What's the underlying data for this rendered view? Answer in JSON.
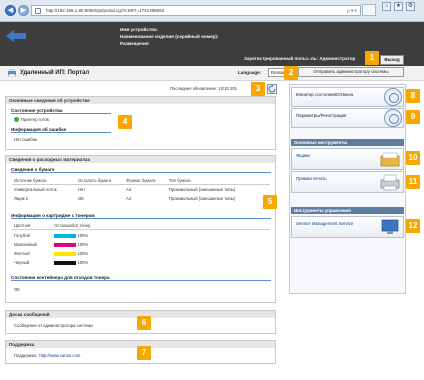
{
  "browser": {
    "address": "http://192.168.1.80:8000/rps/portal.cgi?CSRT=1741398653",
    "back_symbol": "◀",
    "forward_symbol": "▶",
    "search_symbol": "ρ ▾ ¢"
  },
  "device_header": {
    "device_name_label": "Имя устройства:",
    "product_name_label": "Наименование изделия (серийный номер):",
    "location_label": "Размещение:",
    "logged_user": "Зарегистрированный польз.-ль: Администратор",
    "logout_label": "Выход",
    "send_admin_label": "Отправить администратору системы"
  },
  "titlebar": {
    "title": "Удаленный ИП: Портал",
    "language_label": "Language:",
    "language_value": "Russian"
  },
  "update_line": "Последнее обновление: 12/10 201",
  "device_info": {
    "header": "Основные сведения об устройстве",
    "status_title": "Состояние устройства",
    "status_value": "Принтер готов.",
    "error_title": "Информация об ошибке",
    "error_value": "Нет ошибок."
  },
  "consumables": {
    "header": "Сведения о расходных материалах",
    "paper_title": "Сведения о бумаге",
    "paper_columns": [
      "Источник бумаги",
      "Осталось бумаги",
      "Формат бумаги",
      "Тип бумаги"
    ],
    "paper_rows": [
      [
        "Универсальный лоток",
        "Нет",
        "A4",
        "Произвольный (смешанные типы)"
      ],
      [
        "Ящик 1",
        "OK",
        "A4",
        "Произвольный (смешанные типы)"
      ]
    ],
    "toner_title": "Информация о картридже с тонером",
    "toner_columns": [
      "Цветной",
      "Оставшийся тонер"
    ],
    "toner_rows": [
      {
        "name": "Голубой",
        "value": "100%",
        "color": "#00b4e6"
      },
      {
        "name": "Малиновый",
        "value": "100%",
        "color": "#e0007a"
      },
      {
        "name": "Желтый",
        "value": "100%",
        "color": "#ffe600"
      },
      {
        "name": "Черный",
        "value": "100%",
        "color": "#111111"
      }
    ],
    "waste_title": "Состояние контейнера для отходов тонера",
    "waste_value": "OK"
  },
  "messages": {
    "header": "Доска сообщений",
    "value": "Сообщение от администратора системы"
  },
  "support": {
    "header": "Поддержка",
    "label": "Поддержка",
    "link": "http://www.canon.com"
  },
  "sidebar": {
    "status_monitor": "Монитор состояния/Отмена",
    "settings": "Параметры/Регистрация",
    "basic_tools_header": "Основные инструменты",
    "inbox": "Ящики",
    "direct_print": "Прямая печать",
    "mgmt_tools_header": "Инструменты управления",
    "service_mgmt": "Service Management Service"
  },
  "callouts": [
    "1",
    "2",
    "3",
    "4",
    "5",
    "6",
    "7",
    "8",
    "9",
    "10",
    "11",
    "12"
  ],
  "colors": {
    "callout": "#f7a800",
    "header_dark": "#3d3d3d",
    "accent_blue": "#5a8fd4"
  }
}
